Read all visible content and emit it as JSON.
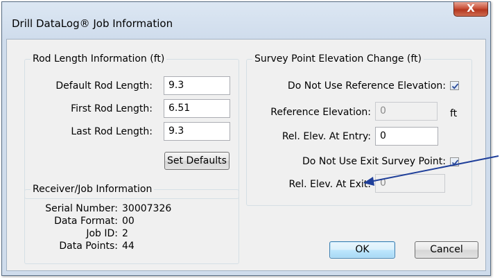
{
  "window": {
    "title": "Drill DataLog® Job Information",
    "close_label": "X"
  },
  "rod_group": {
    "legend": "Rod Length Information (ft)",
    "default_label": "Default Rod Length:",
    "default_value": "9.3",
    "first_label": "First Rod Length:",
    "first_value": "6.51",
    "last_label": "Last Rod Length:",
    "last_value": "9.3",
    "set_defaults": "Set Defaults"
  },
  "receiver_group": {
    "legend": "Receiver/Job Information",
    "serial_label": "Serial Number:",
    "serial_value": "30007326",
    "format_label": "Data Format:",
    "format_value": "00",
    "job_label": "Job ID:",
    "job_value": "2",
    "points_label": "Data Points:",
    "points_value": "44"
  },
  "survey_group": {
    "legend": "Survey Point Elevation Change (ft)",
    "no_ref_label": "Do Not Use Reference Elevation:",
    "no_ref_checked": true,
    "ref_elev_label": "Reference Elevation:",
    "ref_elev_value": "0",
    "ref_unit": "ft",
    "entry_label": "Rel. Elev. At Entry:",
    "entry_value": "0",
    "no_exit_label": "Do Not Use Exit Survey Point:",
    "no_exit_checked": true,
    "exit_label": "Rel. Elev. At Exit:",
    "exit_value": "0"
  },
  "buttons": {
    "ok": "OK",
    "cancel": "Cancel"
  },
  "colors": {
    "annotation_arrow": "#1f3f9a",
    "check_mark": "#2a4a9a"
  }
}
